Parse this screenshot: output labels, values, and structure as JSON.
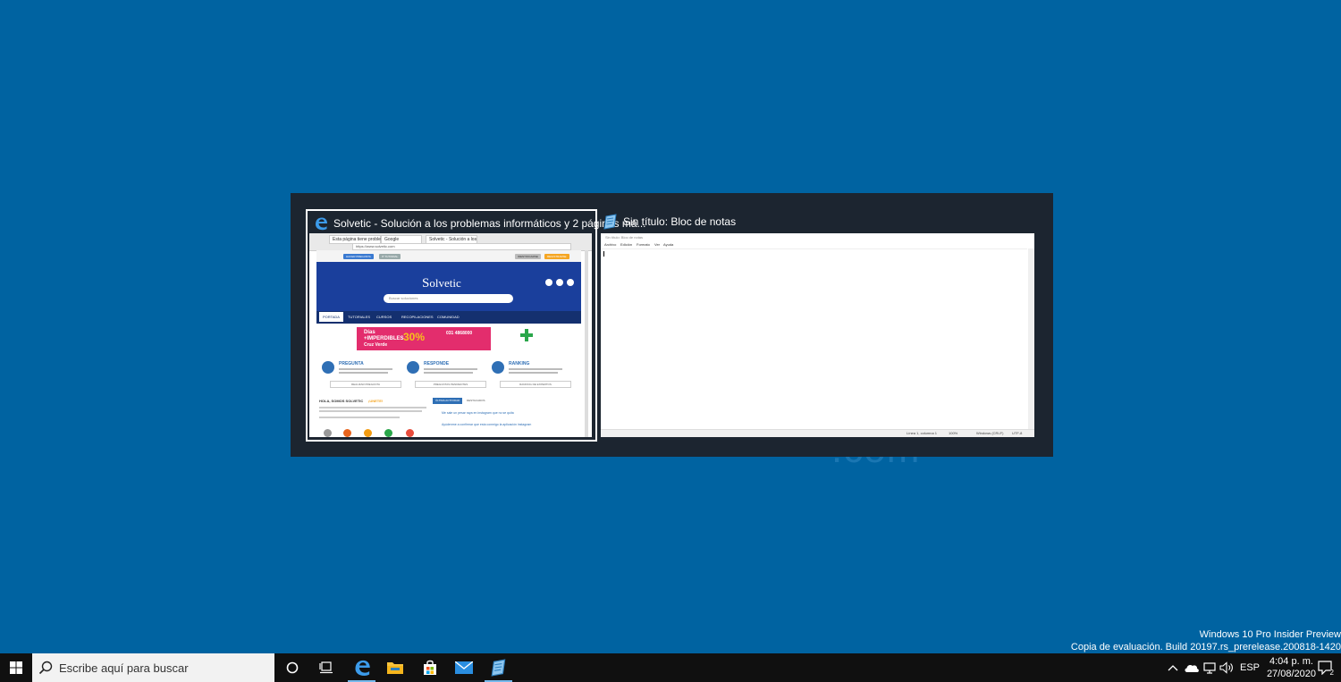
{
  "desktop": {
    "watermark_text": ".com"
  },
  "switcher": {
    "windows": [
      {
        "title": "Solvetic - Solución a los problemas informáticos y 2 páginas má...",
        "icon": "edge-icon",
        "selected": true
      },
      {
        "title": "Sin título: Bloc de notas",
        "icon": "notepad-icon",
        "selected": false
      }
    ]
  },
  "edge_thumb": {
    "tabs": [
      "Esta página tiene problemas",
      "Google",
      "Solvetic - Solución a los"
    ],
    "url": "https://www.solvetic.com",
    "site": {
      "top_buttons": [
        "HACER PREGUNTA",
        "IT TUTORIAL",
        "IDENTIFICARSE",
        "REGISTRARSE"
      ],
      "logo": "olvetic",
      "search_placeholder": "Buscar soluciones",
      "nav": [
        "PORTADA",
        "TUTORIALES",
        "CURSOS",
        "RECOPILACIONES",
        "COMUNIDAD"
      ],
      "banner": {
        "line1": "Días",
        "line2": "+IMPERDIBLES",
        "line3": "Cruz Verde",
        "discount": "30%",
        "phone": "031 4868000"
      },
      "columns": [
        {
          "title": "PREGUNTA",
          "button": "REALIZAR PREGUNTA"
        },
        {
          "title": "RESPONDE",
          "button": "PREGUNTAS PENDIENTES"
        },
        {
          "title": "RANKING",
          "button": "RANKING DE EXPERTOS"
        }
      ],
      "greeting": "HOLA, SOMOS SOLVETIC",
      "greeting_link": "¡UNETE!",
      "activity_tab": "ÚLTIMA ACTIVIDAD",
      "activity_tab2": "DESTACADOS",
      "activity": [
        "Me sale un pesar raya en instagram que no se quita",
        "Ayúdenme a confirmar que esta conmigo la aplicación instagram"
      ]
    }
  },
  "notepad_thumb": {
    "title": "Sin título: Bloc de notas",
    "menu": [
      "Archivo",
      "Edición",
      "Formato",
      "Ver",
      "Ayuda"
    ],
    "status": [
      "Línea 1, columna 1",
      "100%",
      "Windows (CRLF)",
      "UTF-8"
    ]
  },
  "watermark": {
    "line1": "Windows 10 Pro Insider Preview",
    "line2": "Copia de evaluación. Build 20197.rs_prerelease.200818-1420"
  },
  "taskbar": {
    "search_placeholder": "Escribe aquí para buscar",
    "apps": [
      "cortana-icon",
      "task-view-icon",
      "edge-icon",
      "file-explorer-icon",
      "store-icon",
      "mail-icon",
      "notepad-icon"
    ],
    "language": "ESP",
    "time": "4:04 p. m.",
    "date": "27/08/2020",
    "notification_count": "2"
  },
  "colors": {
    "desktop": "#0063a1",
    "switcher": "#1c2530",
    "taskbar": "#101010"
  }
}
